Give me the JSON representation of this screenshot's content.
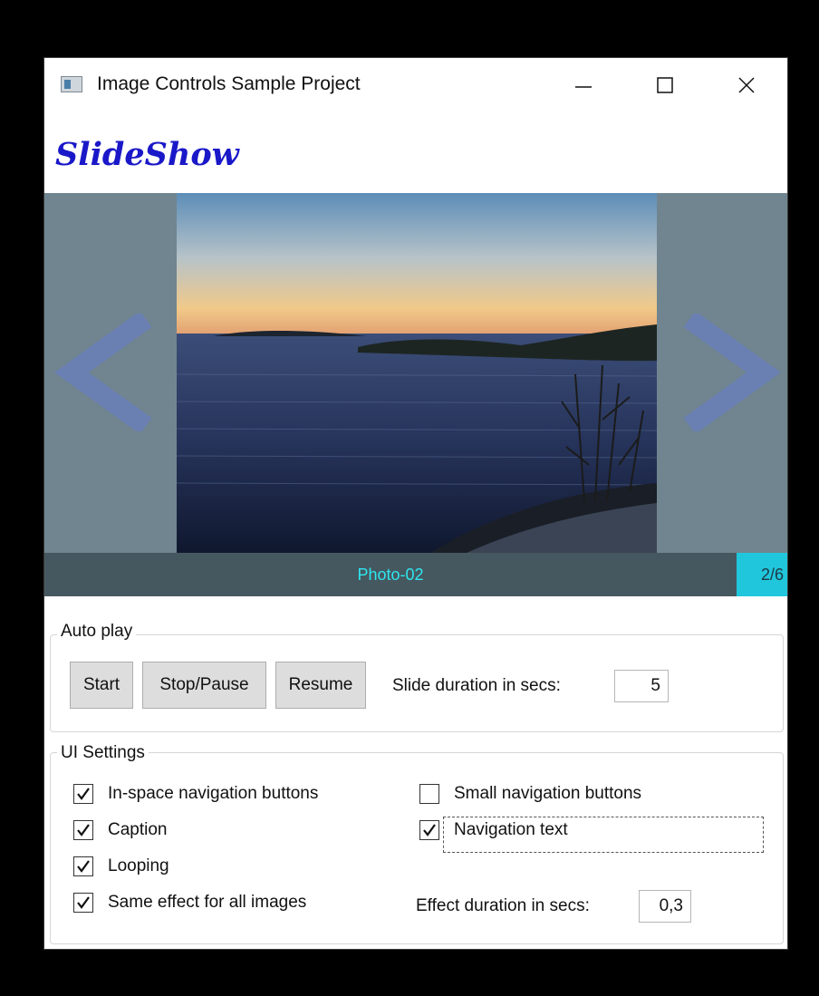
{
  "window": {
    "title": "Image Controls Sample Project",
    "icon": "app-window-icon"
  },
  "heading": "SlideShow",
  "viewer": {
    "caption": "Photo-02",
    "counter": "2/6",
    "prev_icon": "chevron-left-icon",
    "next_icon": "chevron-right-icon",
    "caption_color": "#2de6f0",
    "counter_bg": "#20c6dc"
  },
  "autoplay": {
    "label": "Auto play",
    "start": "Start",
    "stop_pause": "Stop/Pause",
    "resume": "Resume",
    "duration_label": "Slide duration in secs:",
    "duration_value": "5"
  },
  "ui_settings": {
    "label": "UI Settings",
    "options": [
      {
        "label": "In-space navigation buttons",
        "checked": true
      },
      {
        "label": "Caption",
        "checked": true
      },
      {
        "label": "Looping",
        "checked": true
      },
      {
        "label": "Same effect for all images",
        "checked": true
      },
      {
        "label": "Small navigation buttons",
        "checked": false
      },
      {
        "label": "Navigation text",
        "checked": true
      }
    ],
    "effect_label": "Effect duration in secs:",
    "effect_value": "0,3"
  }
}
